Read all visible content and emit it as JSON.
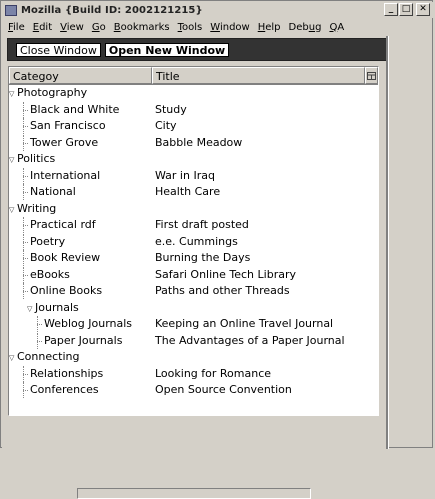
{
  "window": {
    "title": "Mozilla {Build ID: 2002121215}"
  },
  "menu": [
    {
      "acc": "F",
      "rest": "ile"
    },
    {
      "acc": "E",
      "rest": "dit"
    },
    {
      "acc": "V",
      "rest": "iew"
    },
    {
      "acc": "G",
      "rest": "o"
    },
    {
      "acc": "B",
      "rest": "ookmarks"
    },
    {
      "acc": "T",
      "rest": "ools"
    },
    {
      "acc": "W",
      "rest": "indow"
    },
    {
      "acc": "H",
      "rest": "elp"
    },
    {
      "pre": "Deb",
      "acc": "u",
      "rest": "g"
    },
    {
      "acc": "Q",
      "rest": "A"
    }
  ],
  "toolbar": {
    "close_label": "Close Window",
    "open_label": "Open New Window"
  },
  "columns": {
    "category": "Categoy",
    "title": "Title"
  },
  "rows": [
    {
      "cat": "Photography",
      "title": "",
      "level": 0,
      "container": true
    },
    {
      "cat": "Black and White",
      "title": "Study",
      "level": 1
    },
    {
      "cat": "San Francisco",
      "title": "City",
      "level": 1
    },
    {
      "cat": "Tower Grove",
      "title": "Babble Meadow",
      "level": 1
    },
    {
      "cat": "Politics",
      "title": "",
      "level": 0,
      "container": true
    },
    {
      "cat": "International",
      "title": "War in Iraq",
      "level": 1
    },
    {
      "cat": "National",
      "title": "Health Care",
      "level": 1
    },
    {
      "cat": "Writing",
      "title": "",
      "level": 0,
      "container": true
    },
    {
      "cat": "Practical rdf",
      "title": "First draft posted",
      "level": 1
    },
    {
      "cat": "Poetry",
      "title": "e.e. Cummings",
      "level": 1
    },
    {
      "cat": "Book Review",
      "title": "Burning the Days",
      "level": 1
    },
    {
      "cat": "eBooks",
      "title": "Safari Online Tech Library",
      "level": 1
    },
    {
      "cat": "Online Books",
      "title": "Paths and other Threads",
      "level": 1
    },
    {
      "cat": "Journals",
      "title": "",
      "level": 1,
      "container": true
    },
    {
      "cat": "Weblog Journals",
      "title": "Keeping an Online Travel Journal",
      "level": 2
    },
    {
      "cat": "Paper Journals",
      "title": "The Advantages of a Paper Journal",
      "level": 2
    },
    {
      "cat": "Connecting",
      "title": "",
      "level": 0,
      "container": true
    },
    {
      "cat": "Relationships",
      "title": "Looking for Romance",
      "level": 1
    },
    {
      "cat": "Conferences",
      "title": "Open Source Convention",
      "level": 1
    }
  ]
}
